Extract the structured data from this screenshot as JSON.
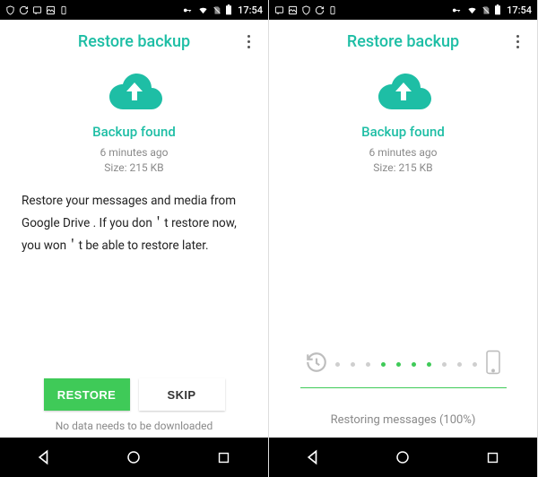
{
  "statusbar": {
    "clock": "17:54"
  },
  "title": "Restore backup",
  "backup": {
    "found": "Backup found",
    "time": "6 minutes ago",
    "size": "Size: 215 KB"
  },
  "left": {
    "description": "Restore your messages and media from Google Drive . If you don＇t restore now, you won＇t be able to restore later.",
    "restore_label": "RESTORE",
    "skip_label": "SKIP",
    "footnote": "No data needs to be downloaded"
  },
  "right": {
    "progress_label": "Restoring messages (100%)"
  }
}
